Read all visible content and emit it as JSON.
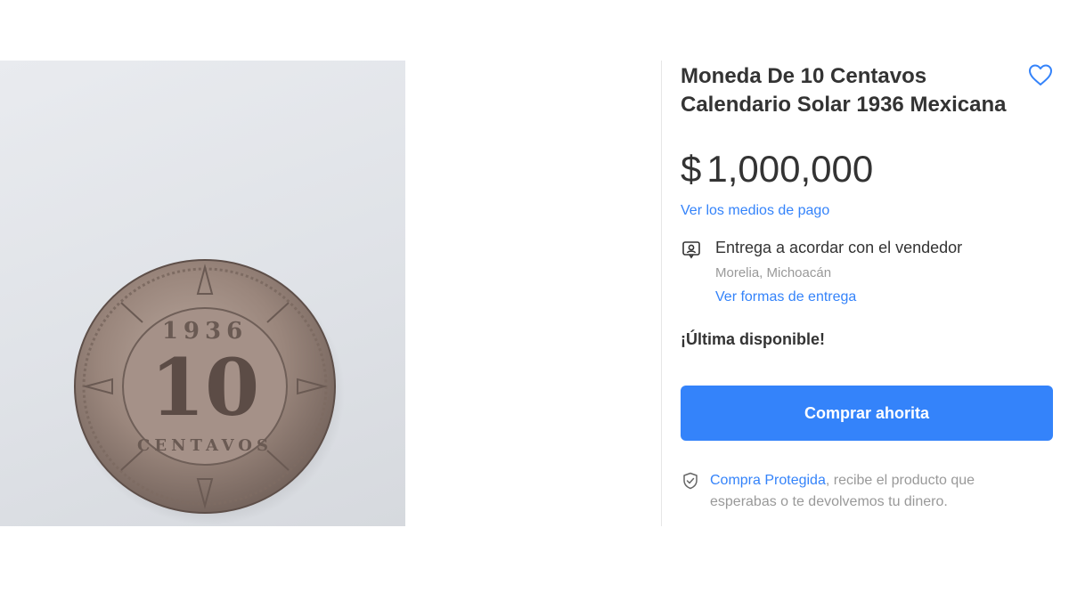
{
  "product": {
    "title": "Moneda De 10 Centavos Calendario Solar 1936 Mexicana",
    "image_icon": "coin-photo",
    "coin_year": "1936",
    "coin_value": "10",
    "coin_word": "CENTAVOS"
  },
  "favorite": {
    "icon": "heart-icon"
  },
  "price": {
    "currency": "$",
    "amount": "1,000,000"
  },
  "payment": {
    "link": "Ver los medios de pago"
  },
  "delivery": {
    "icon": "delivery-person-icon",
    "title": "Entrega a acordar con el vendedor",
    "location": "Morelia, Michoacán",
    "link": "Ver formas de entrega"
  },
  "stock": {
    "text": "¡Última disponible!"
  },
  "buy": {
    "label": "Comprar ahorita"
  },
  "protection": {
    "icon": "shield-check-icon",
    "link": "Compra Protegida",
    "text": ", recibe el producto que esperabas o te devolvemos tu dinero."
  },
  "colors": {
    "accent": "#3483fa",
    "text": "#333333",
    "muted": "#999999"
  }
}
